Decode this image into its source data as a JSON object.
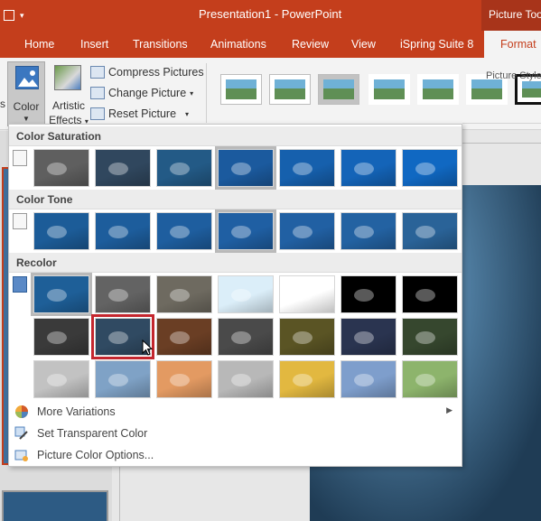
{
  "titlebar": {
    "title": "Presentation1  -  PowerPoint",
    "context_tab": "Picture Tools"
  },
  "tabs": [
    {
      "label": "Home"
    },
    {
      "label": "Insert"
    },
    {
      "label": "Transitions"
    },
    {
      "label": "Animations"
    },
    {
      "label": "Review"
    },
    {
      "label": "View"
    },
    {
      "label": "iSpring Suite 8"
    },
    {
      "label": "Format"
    }
  ],
  "ribbon": {
    "left_cut": "s",
    "color_label": "Color",
    "artistic_line1": "Artistic",
    "artistic_line2": "Effects",
    "compress": "Compress Pictures",
    "change": "Change Picture",
    "reset": "Reset Picture",
    "styles_group": "Picture Style"
  },
  "dropdown": {
    "sections": {
      "saturation": "Color Saturation",
      "tone": "Color Tone",
      "recolor": "Recolor"
    },
    "saturation_colors": [
      "#5f5f5f",
      "#30475e",
      "#235a86",
      "#1b5a9e",
      "#1660ad",
      "#1464b8",
      "#1068c2"
    ],
    "tone_colors": [
      "#1c5c98",
      "#1d5d9c",
      "#1e5e9f",
      "#1f5fa3",
      "#2160a3",
      "#2362a2",
      "#2a6398"
    ],
    "recolor_rows": [
      [
        "#1e5f98",
        "#636363",
        "#6e6a60",
        "#dbeef9",
        "#ffffff",
        "#000000",
        "#000000"
      ],
      [
        "#3a3a3a",
        "#304a62",
        "#6a3e24",
        "#4a4a4a",
        "#5a5424",
        "#2a3450",
        "#36472e"
      ],
      [
        "#c2c2c2",
        "#7fa2c6",
        "#e39a62",
        "#b8b8b8",
        "#e2b840",
        "#7e9ecc",
        "#8db46c"
      ]
    ],
    "menu": {
      "more_variations": "More Variations",
      "set_transparent": "Set Transparent Color",
      "options": "Picture Color Options..."
    }
  }
}
